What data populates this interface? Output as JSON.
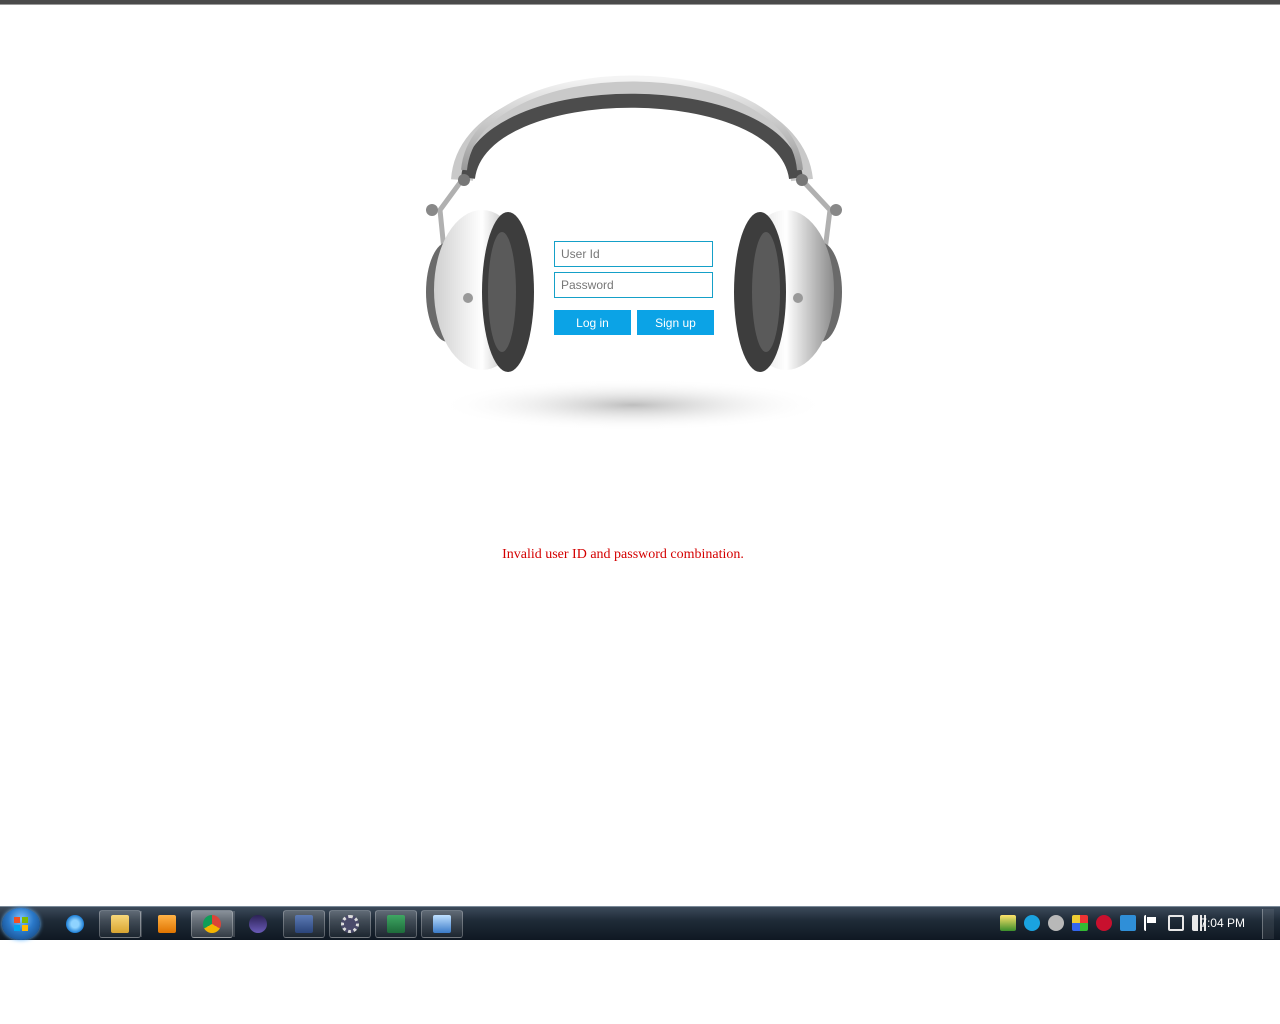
{
  "login": {
    "user_id_placeholder": "User Id",
    "password_placeholder": "Password",
    "login_label": "Log in",
    "signup_label": "Sign up"
  },
  "error_message": "Invalid user ID and password combination.",
  "taskbar": {
    "clock": "7:04 PM",
    "pinned": [
      {
        "name": "internet-explorer",
        "icon": "ie-icon"
      },
      {
        "name": "windows-explorer",
        "icon": "folder-icon"
      },
      {
        "name": "media-player",
        "icon": "media-player-icon"
      },
      {
        "name": "chrome",
        "icon": "chrome-icon"
      },
      {
        "name": "eclipse",
        "icon": "eclipse-icon"
      },
      {
        "name": "app",
        "icon": "app-icon"
      },
      {
        "name": "settings",
        "icon": "gear-icon"
      },
      {
        "name": "excel",
        "icon": "excel-icon"
      },
      {
        "name": "remote-desktop",
        "icon": "window-icon"
      }
    ],
    "tray_icons": [
      "security-icon",
      "skype-icon",
      "cloud-icon",
      "network-app-icon",
      "record-icon",
      "bluetooth-icon",
      "flag-icon",
      "network-icon",
      "volume-icon"
    ]
  },
  "colors": {
    "accent": "#0ba3e6",
    "input_border": "#15a0c8",
    "error": "#d40000"
  }
}
